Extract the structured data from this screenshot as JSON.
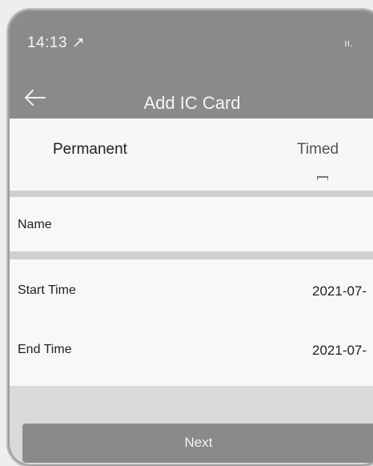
{
  "status_bar": {
    "time": "14:13",
    "location_glyph": "↗",
    "right_indicator": "ıı. "
  },
  "header": {
    "back_icon": "arrow-left-icon",
    "title": "Add IC Card"
  },
  "tabs": [
    {
      "label": "Permanent",
      "selected": true
    },
    {
      "label": "Timed",
      "selected": false
    }
  ],
  "form": {
    "name": {
      "label": "Name",
      "value": ""
    },
    "start_time": {
      "label": "Start Time",
      "value": "2021-07-"
    },
    "end_time": {
      "label": "End Time",
      "value": "2021-07-"
    }
  },
  "footer": {
    "next_label": "Next"
  },
  "colors": {
    "header_bg": "#8a8a8a",
    "button_bg": "#8a8a8a",
    "page_bg": "#d9d9d9",
    "row_bg": "#f8f8f8"
  }
}
